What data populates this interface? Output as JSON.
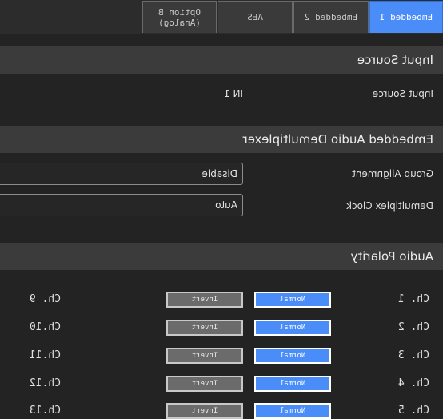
{
  "tabs": [
    {
      "label": "Embedded 1",
      "active": true
    },
    {
      "label": "Embedded 2",
      "active": false
    },
    {
      "label": "AES",
      "active": false
    },
    {
      "label": "Option B\n(Analog)",
      "active": false
    }
  ],
  "input_source": {
    "title": "Input Source",
    "label": "Input Source",
    "value": "IN 1"
  },
  "demux": {
    "title": "Embedded Audio Demultiplexer",
    "group_alignment_label": "Group Alignment",
    "group_alignment_value": "Disable",
    "demux_clock_label": "Demultiplex Clock",
    "demux_clock_value": "Auto"
  },
  "polarity": {
    "title": "Audio Polarity",
    "rows": [
      {
        "left": "Ch. 1",
        "normal": "Normal",
        "invert": "Invert",
        "right": "Ch. 9"
      },
      {
        "left": "Ch. 2",
        "normal": "Normal",
        "invert": "Invert",
        "right": "Ch.10"
      },
      {
        "left": "Ch. 3",
        "normal": "Normal",
        "invert": "Invert",
        "right": "Ch.11"
      },
      {
        "left": "Ch. 4",
        "normal": "Normal",
        "invert": "Invert",
        "right": "Ch.12"
      },
      {
        "left": "Ch. 5",
        "normal": "Normal",
        "invert": "Invert",
        "right": "Ch.13"
      }
    ]
  },
  "colors": {
    "accent": "#4b8df8",
    "background": "#232323",
    "header": "#3b3b3b"
  }
}
